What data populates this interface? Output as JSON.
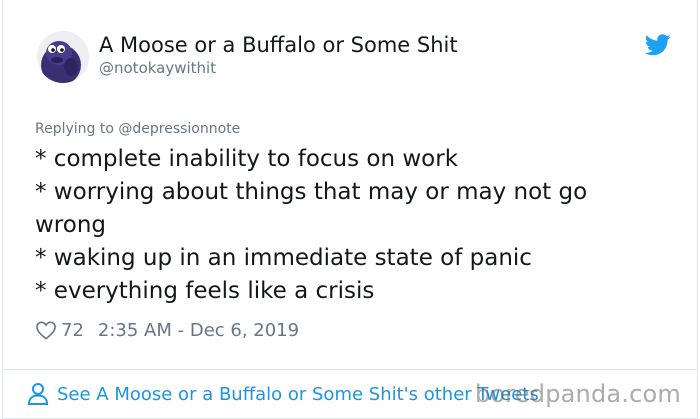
{
  "author": {
    "name": "A Moose or a Buffalo or Some Shit",
    "handle": "@notokaywithit"
  },
  "reply": {
    "text": "Replying to @depressionnote"
  },
  "tweet": {
    "lines": [
      "* complete inability to focus on work",
      "* worrying about things that may or may not go",
      "wrong",
      "* waking up in an immediate state of panic",
      "* everything feels like a crisis"
    ]
  },
  "meta": {
    "likes": "72",
    "timestamp": "2:35 AM - Dec 6, 2019"
  },
  "footer": {
    "see_more": "See A Moose or a Buffalo or Some Shit's other Tweets"
  },
  "watermark": {
    "text": "boredpanda.com"
  },
  "colors": {
    "text": "#14171a",
    "secondary": "#657786",
    "link": "#1b95e0",
    "twitter_blue": "#1da1f2",
    "border": "#e1e8ed"
  },
  "icons": [
    "avatar-image",
    "twitter-bird-icon",
    "heart-icon",
    "person-icon"
  ]
}
